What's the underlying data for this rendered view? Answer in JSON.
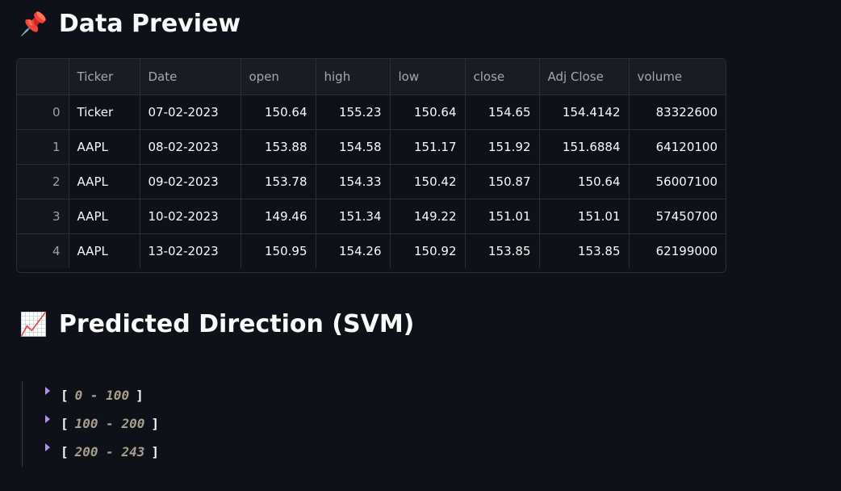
{
  "section1": {
    "emoji": "📌",
    "icon": "pushpin-icon",
    "title": "Data Preview"
  },
  "table": {
    "columns": [
      "",
      "Ticker",
      "Date",
      "open",
      "high",
      "low",
      "close",
      "Adj Close",
      "volume"
    ],
    "rows": [
      [
        "0",
        "Ticker",
        "07-02-2023",
        "150.64",
        "155.23",
        "150.64",
        "154.65",
        "154.4142",
        "83322600"
      ],
      [
        "1",
        "AAPL",
        "08-02-2023",
        "153.88",
        "154.58",
        "151.17",
        "151.92",
        "151.6884",
        "64120100"
      ],
      [
        "2",
        "AAPL",
        "09-02-2023",
        "153.78",
        "154.33",
        "150.42",
        "150.87",
        "150.64",
        "56007100"
      ],
      [
        "3",
        "AAPL",
        "10-02-2023",
        "149.46",
        "151.34",
        "149.22",
        "151.01",
        "151.01",
        "57450700"
      ],
      [
        "4",
        "AAPL",
        "13-02-2023",
        "150.95",
        "154.26",
        "150.92",
        "153.85",
        "153.85",
        "62199000"
      ]
    ]
  },
  "section2": {
    "emoji": "📈",
    "icon": "chart-increasing-icon",
    "title": "Predicted Direction (SVM)"
  },
  "json_tree": {
    "caret_color": "#b58ff0",
    "groups": [
      {
        "open": "[",
        "range": "0 - 100",
        "close": "]"
      },
      {
        "open": "[",
        "range": "100 - 200",
        "close": "]"
      },
      {
        "open": "[",
        "range": "200 - 243",
        "close": "]"
      }
    ]
  }
}
